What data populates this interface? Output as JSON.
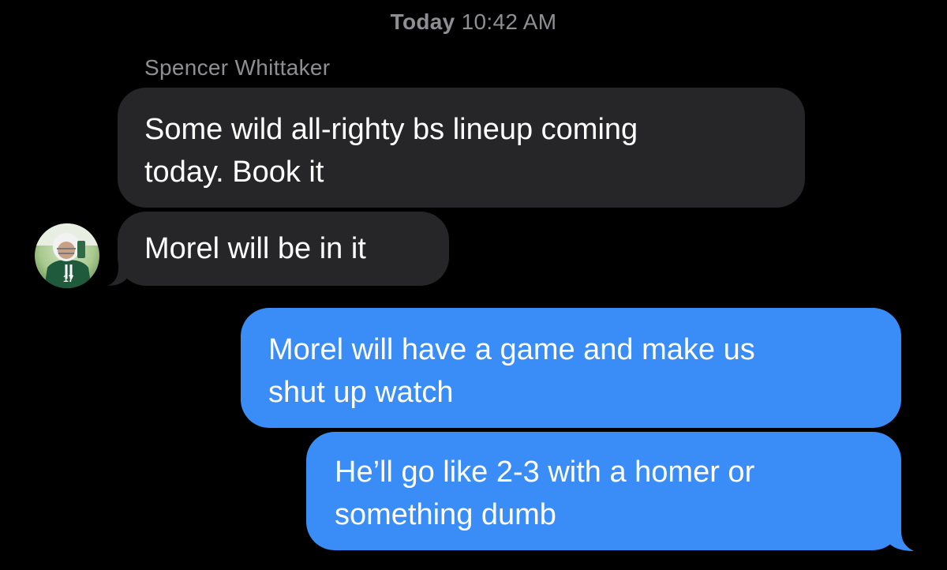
{
  "thread": {
    "timestamp_day": "Today",
    "timestamp_time": "10:42 AM",
    "sender_name": "Spencer Whittaker"
  },
  "messages": [
    {
      "direction": "incoming",
      "lines": [
        "Some wild all-righty bs lineup coming",
        "today. Book it"
      ]
    },
    {
      "direction": "incoming",
      "lines": [
        "Morel will be in it"
      ]
    },
    {
      "direction": "outgoing",
      "lines": [
        "Morel will have a game and make us",
        "shut up watch"
      ]
    },
    {
      "direction": "outgoing",
      "lines": [
        "He’ll go like 2-3 with a homer or",
        "something dumb"
      ]
    }
  ],
  "avatar": {
    "icon": "contact-photo-football-player",
    "jersey_number": "17"
  },
  "colors": {
    "background": "#000000",
    "incoming_bubble": "#262628",
    "outgoing_bubble": "#3a8df7",
    "secondary_text": "#8e8e93",
    "primary_text": "#ffffff"
  }
}
